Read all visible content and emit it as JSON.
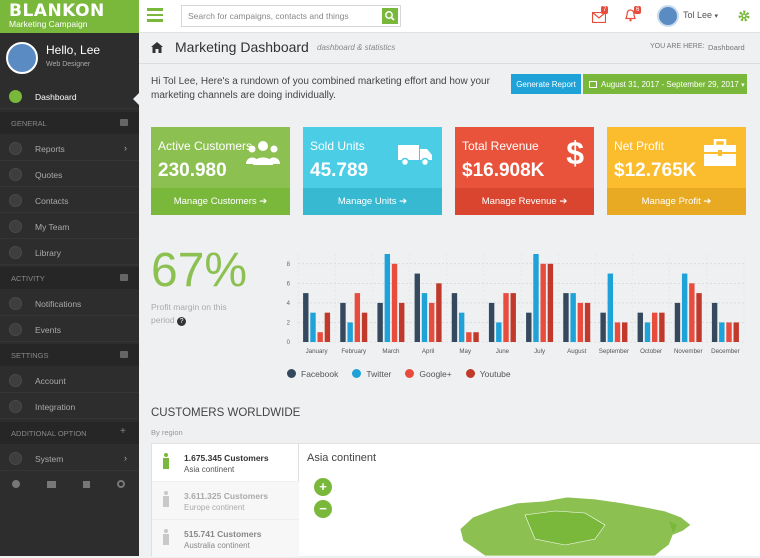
{
  "logo": {
    "name": "BLANKON",
    "tagline": "Marketing Campaign"
  },
  "topbar": {
    "search_placeholder": "Search for campaigns, contacts and things",
    "mail_count": "7",
    "notif_count": "6",
    "user_name": "Tol Lee"
  },
  "sidebar": {
    "hello": "Hello,",
    "name": "Lee",
    "role": "Web Designer",
    "dashboard": "Dashboard",
    "sections": [
      {
        "title": "GENERAL",
        "items": [
          "Reports",
          "Quotes",
          "Contacts",
          "My Team",
          "Library"
        ]
      },
      {
        "title": "ACTIVITY",
        "items": [
          "Notifications",
          "Events"
        ]
      },
      {
        "title": "SETTINGS",
        "items": [
          "Account",
          "Integration"
        ]
      },
      {
        "title": "ADDITIONAL OPTION",
        "items": [
          "System"
        ]
      }
    ]
  },
  "page": {
    "title": "Marketing Dashboard",
    "subtitle": "dashboard & statistics",
    "you_are_here": "YOU ARE HERE:",
    "breadcrumb": "Dashboard",
    "intro": "Hi Tol Lee, Here's a rundown of you combined marketing effort and how your marketing channels are doing individually.",
    "generate_report": "Generate Report",
    "date_range": "August 31, 2017 - September 29, 2017"
  },
  "cards": [
    {
      "title": "Active Customers",
      "value": "230.980",
      "link": "Manage Customers",
      "icon": "users-icon"
    },
    {
      "title": "Sold Units",
      "value": "45.789",
      "link": "Manage Units",
      "icon": "truck-icon"
    },
    {
      "title": "Total Revenue",
      "value": "$16.908K",
      "link": "Manage Revenue",
      "icon": "dollar-icon"
    },
    {
      "title": "Net Profit",
      "value": "$12.765K",
      "link": "Manage Profit",
      "icon": "briefcase-icon"
    }
  ],
  "profit": {
    "percent": "67%",
    "label": "Profit margin on this period"
  },
  "chart_data": {
    "type": "bar",
    "categories": [
      "January",
      "February",
      "March",
      "April",
      "May",
      "June",
      "July",
      "August",
      "September",
      "October",
      "November",
      "December"
    ],
    "ylim": [
      0,
      9
    ],
    "yticks": [
      0,
      2,
      4,
      6,
      8
    ],
    "series": [
      {
        "name": "Facebook",
        "color": "#34495e",
        "values": [
          5,
          4,
          4,
          7,
          5,
          4,
          3,
          5,
          3,
          3,
          4,
          4
        ]
      },
      {
        "name": "Twitter",
        "color": "#1ea2d8",
        "values": [
          3,
          2,
          9,
          5,
          3,
          2,
          9,
          5,
          7,
          2,
          7,
          2
        ]
      },
      {
        "name": "Google+",
        "color": "#e74c3c",
        "values": [
          1,
          5,
          8,
          4,
          1,
          5,
          8,
          4,
          2,
          3,
          6,
          2
        ]
      },
      {
        "name": "Youtube",
        "color": "#c0392b",
        "values": [
          3,
          3,
          4,
          6,
          1,
          5,
          8,
          4,
          2,
          3,
          5,
          2
        ]
      }
    ]
  },
  "customers": {
    "title": "CUSTOMERS WORLDWIDE",
    "subtitle": "By region",
    "regions": [
      {
        "count": "1.675.345 Customers",
        "name": "Asia continent"
      },
      {
        "count": "3.611.325 Customers",
        "name": "Europe continent"
      },
      {
        "count": "515.741 Customers",
        "name": "Australia continent"
      }
    ],
    "map_title": "Asia continent"
  }
}
